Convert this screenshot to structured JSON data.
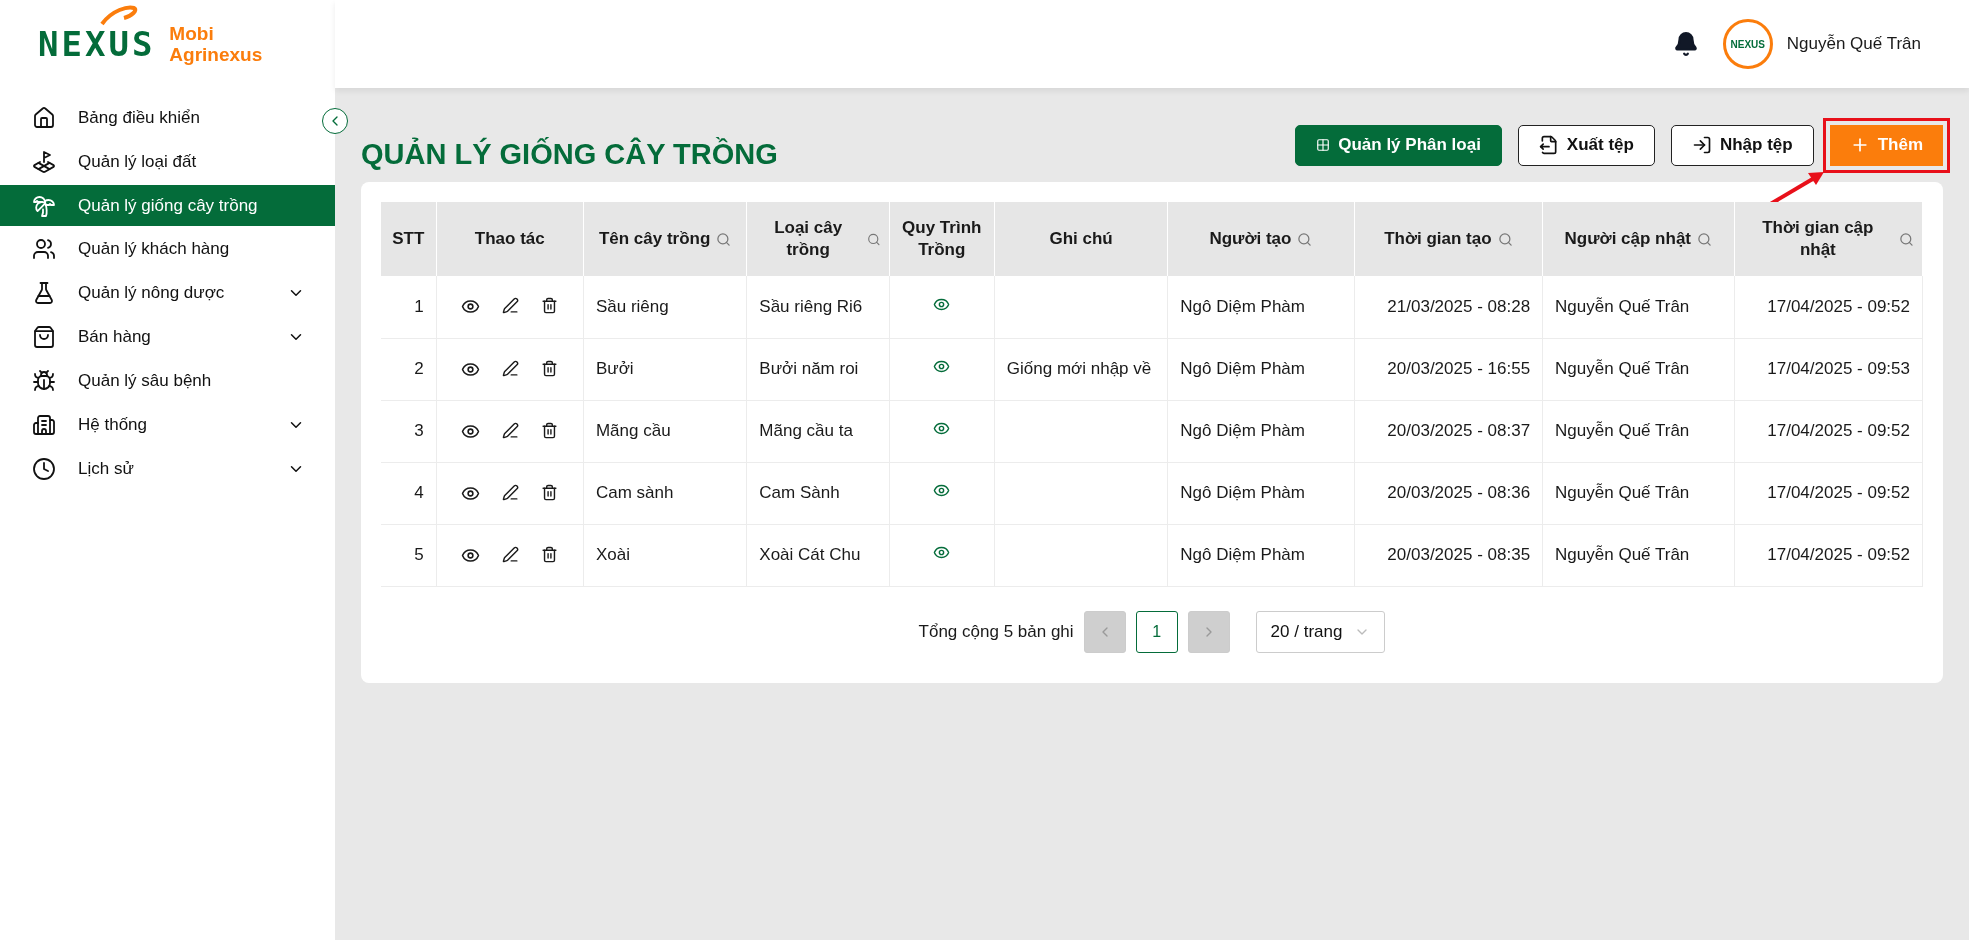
{
  "brand": {
    "logo": "NEXUS",
    "name_line1": "Mobi",
    "name_line2": "Agrinexus"
  },
  "header": {
    "avatar_text": "NEXUS",
    "user_name": "Nguyễn Quế Trân"
  },
  "sidebar": {
    "items": [
      {
        "label": "Bảng điều khiển",
        "selected": false,
        "expandable": false
      },
      {
        "label": "Quản lý loại đất",
        "selected": false,
        "expandable": false
      },
      {
        "label": "Quản lý giống cây trồng",
        "selected": true,
        "expandable": false
      },
      {
        "label": "Quản lý khách hàng",
        "selected": false,
        "expandable": false
      },
      {
        "label": "Quản lý nông dược",
        "selected": false,
        "expandable": true
      },
      {
        "label": "Bán hàng",
        "selected": false,
        "expandable": true
      },
      {
        "label": "Quản lý sâu bệnh",
        "selected": false,
        "expandable": false
      },
      {
        "label": "Hệ thống",
        "selected": false,
        "expandable": true
      },
      {
        "label": "Lịch sử",
        "selected": false,
        "expandable": true
      }
    ]
  },
  "page": {
    "title": "QUẢN LÝ GIỐNG CÂY TRỒNG",
    "actions": [
      {
        "kind": "primary",
        "label": "Quản lý Phân loại",
        "highlight": false
      },
      {
        "kind": "export",
        "label": "Xuất tệp",
        "highlight": false
      },
      {
        "kind": "import",
        "label": "Nhập tệp",
        "highlight": false
      },
      {
        "kind": "add",
        "label": "Thêm",
        "highlight": true
      }
    ]
  },
  "table": {
    "columns": [
      {
        "label": "STT",
        "searchable": false
      },
      {
        "label": "Thao tác",
        "searchable": false
      },
      {
        "label": "Tên cây trồng",
        "searchable": true
      },
      {
        "label": "Loại cây trồng",
        "searchable": true
      },
      {
        "label": "Quy Trình Trồng",
        "searchable": false
      },
      {
        "label": "Ghi chú",
        "searchable": false
      },
      {
        "label": "Người tạo",
        "searchable": true
      },
      {
        "label": "Thời gian tạo",
        "searchable": true
      },
      {
        "label": "Người cập nhật",
        "searchable": true
      },
      {
        "label": "Thời gian cập nhật",
        "searchable": true
      }
    ],
    "rows": [
      {
        "stt": "1",
        "name": "Sầu riêng",
        "type": "Sầu riêng Ri6",
        "note": "",
        "creator": "Ngô Diệm Phàm",
        "created": "21/03/2025 - 08:28",
        "updater": "Nguyễn Quế Trân",
        "updated": "17/04/2025 - 09:52"
      },
      {
        "stt": "2",
        "name": "Bưởi",
        "type": "Bưởi năm roi",
        "note": "Giống mới nhập về",
        "creator": "Ngô Diệm Phàm",
        "created": "20/03/2025 - 16:55",
        "updater": "Nguyễn Quế Trân",
        "updated": "17/04/2025 - 09:53"
      },
      {
        "stt": "3",
        "name": "Mãng cầu",
        "type": "Mãng cầu ta",
        "note": "",
        "creator": "Ngô Diệm Phàm",
        "created": "20/03/2025 - 08:37",
        "updater": "Nguyễn Quế Trân",
        "updated": "17/04/2025 - 09:52"
      },
      {
        "stt": "4",
        "name": "Cam sành",
        "type": "Cam Sành",
        "note": "",
        "creator": "Ngô Diệm Phàm",
        "created": "20/03/2025 - 08:36",
        "updater": "Nguyễn Quế Trân",
        "updated": "17/04/2025 - 09:52"
      },
      {
        "stt": "5",
        "name": "Xoài",
        "type": "Xoài Cát Chu",
        "note": "",
        "creator": "Ngô Diệm Phàm",
        "created": "20/03/2025 - 08:35",
        "updater": "Nguyễn Quế Trân",
        "updated": "17/04/2025 - 09:52"
      }
    ]
  },
  "pagination": {
    "total": "Tổng cộng 5 bản ghi",
    "pages": [
      {
        "label": "1",
        "selected": true
      }
    ],
    "prev_disabled": true,
    "next_disabled": true,
    "page_size": "20 / trang"
  }
}
